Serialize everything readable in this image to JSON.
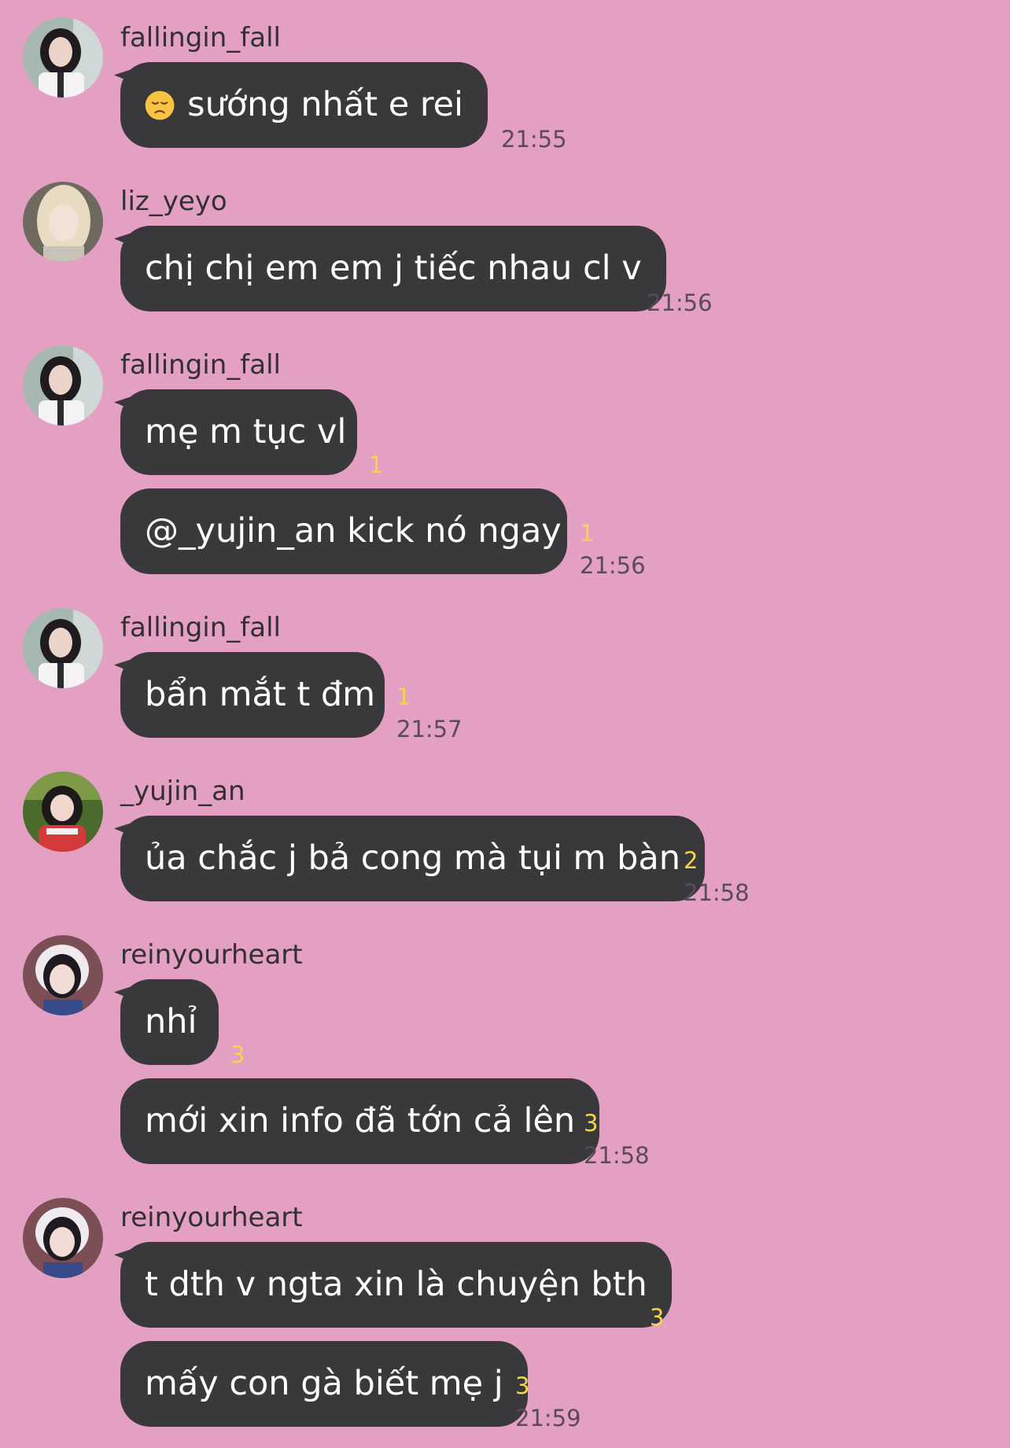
{
  "colors": {
    "background": "#e4a0c3",
    "bubble": "#39383b",
    "bubble_text": "#ffffff",
    "sender_text": "#333033",
    "time_text": "#5b4a57",
    "read_count": "#f3d44f"
  },
  "messages": [
    {
      "sender": "fallingin_fall",
      "avatar": "avatar-photo",
      "bubbles": [
        {
          "emoji": "disappointed-face-icon",
          "text": "sướng nhất e rei",
          "read": "",
          "time": "21:55"
        }
      ]
    },
    {
      "sender": "liz_yeyo",
      "avatar": "avatar-photo",
      "bubbles": [
        {
          "text": "chị chị em em j tiếc nhau cl v",
          "read": "",
          "time": "21:56"
        }
      ]
    },
    {
      "sender": "fallingin_fall",
      "avatar": "avatar-photo",
      "bubbles": [
        {
          "text": "mẹ m tục vl",
          "read": "1",
          "time": ""
        },
        {
          "text": "@_yujin_an kick nó ngay",
          "read": "1",
          "time": "21:56"
        }
      ]
    },
    {
      "sender": "fallingin_fall",
      "avatar": "avatar-photo",
      "bubbles": [
        {
          "text": "bẩn mắt t đm",
          "read": "1",
          "time": "21:57"
        }
      ]
    },
    {
      "sender": "_yujin_an",
      "avatar": "avatar-photo",
      "bubbles": [
        {
          "text": "ủa chắc j bả cong mà tụi m bàn",
          "read": "2",
          "time": "21:58"
        }
      ]
    },
    {
      "sender": "reinyourheart",
      "avatar": "avatar-photo",
      "bubbles": [
        {
          "text": "nhỉ",
          "read": "3",
          "time": ""
        },
        {
          "text": "mới xin info đã tớn cả lên",
          "read": "3",
          "time": "21:58"
        }
      ]
    },
    {
      "sender": "reinyourheart",
      "avatar": "avatar-photo",
      "bubbles": [
        {
          "text": "t dth v ngta xin là chuyện bth",
          "read": "3",
          "time": ""
        },
        {
          "text": "mấy con gà biết mẹ j",
          "read": "3",
          "time": "21:59"
        }
      ]
    }
  ]
}
